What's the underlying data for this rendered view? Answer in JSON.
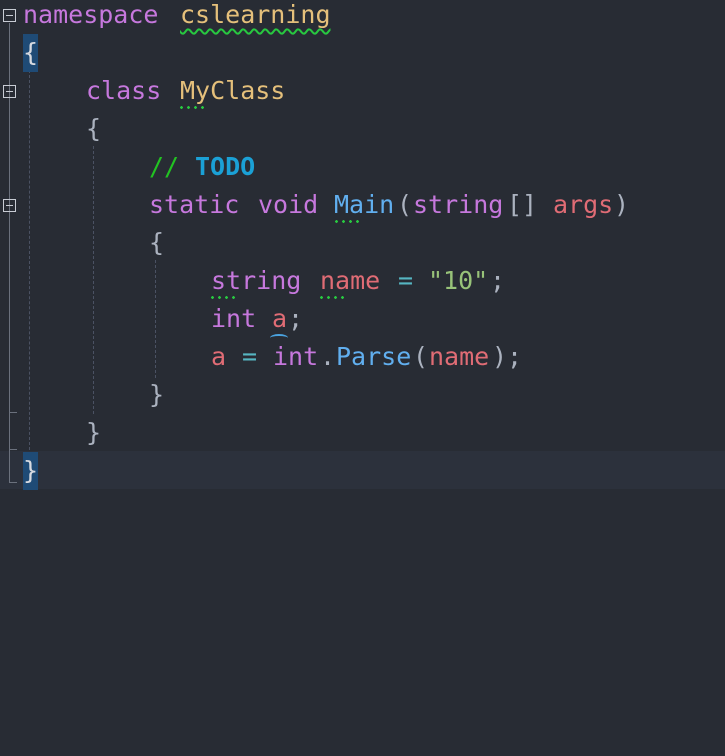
{
  "editor": {
    "colors": {
      "background": "#282c34",
      "current_line": "#2c313c",
      "keyword": "#c678dd",
      "type_name": "#e5c07b",
      "function": "#61afef",
      "variable": "#e06c75",
      "string": "#98c379",
      "comment": "#22c322",
      "todo": "#1ba1d6",
      "brace_highlight": "#1f4b76",
      "warning_squiggle": "#28c840"
    },
    "lines": {
      "l1": {
        "keyword": "namespace",
        "name": "cslearning"
      },
      "l2": {
        "brace": "{"
      },
      "l3": {
        "keyword": "class",
        "name": "MyClass"
      },
      "l4": {
        "brace": "{"
      },
      "l5": {
        "comment": "//",
        "todo": "TODO"
      },
      "l6": {
        "kw1": "static",
        "kw2": "void",
        "fn": "Main",
        "open": "(",
        "type": "string",
        "brackets": "[]",
        "param": "args",
        "close": ")"
      },
      "l7": {
        "brace": "{"
      },
      "l8": {
        "type": "string",
        "var": "name",
        "op": "=",
        "value": "\"10\"",
        "semi": ";"
      },
      "l9": {
        "type": "int",
        "var": "a",
        "semi": ";"
      },
      "l10": {
        "var": "a",
        "op": "=",
        "type": "int",
        "dot": ".",
        "fn": "Parse",
        "open": "(",
        "arg": "name",
        "close": ")",
        "semi": ";"
      },
      "l11": {
        "brace": "}"
      },
      "l12": {
        "brace": "}"
      },
      "l13": {
        "brace": "}"
      }
    },
    "gutter": {
      "fold_icon": "minus-box-icon"
    }
  }
}
